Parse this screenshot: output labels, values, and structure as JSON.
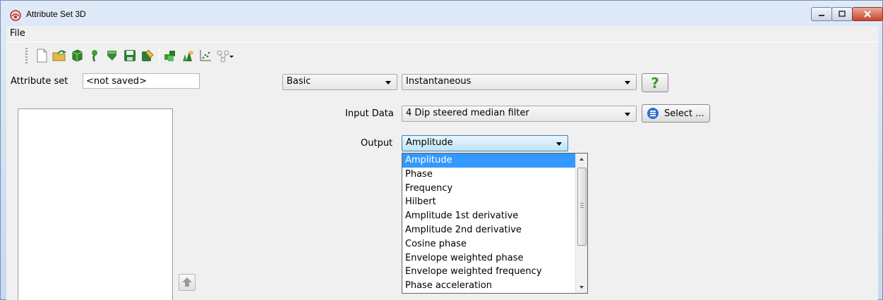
{
  "window": {
    "title": "Attribute Set 3D"
  },
  "menu": {
    "file": "File"
  },
  "toolbar": {
    "icons": [
      "new-file-icon",
      "open-folder-icon",
      "green-cube-icon",
      "tree-icon",
      "arrow-down-icon",
      "save-icon",
      "save-as-icon",
      "stacked-cubes-icon",
      "plants-icon",
      "crossplot-icon",
      "network-icon"
    ]
  },
  "attribute_set": {
    "label": "Attribute set",
    "value": "<not saved>"
  },
  "category_combo": {
    "value": "Basic"
  },
  "attribute_combo": {
    "value": "Instantaneous"
  },
  "help": {
    "symbol": "?"
  },
  "input_data": {
    "label": "Input Data",
    "value": "4 Dip steered median filter",
    "select_label": "Select ..."
  },
  "output": {
    "label": "Output",
    "value": "Amplitude",
    "options": [
      "Amplitude",
      "Phase",
      "Frequency",
      "Hilbert",
      "Amplitude 1st derivative",
      "Amplitude 2nd derivative",
      "Cosine phase",
      "Envelope weighted phase",
      "Envelope weighted frequency",
      "Phase acceleration"
    ],
    "selected_index": 0
  },
  "colors": {
    "selection": "#3399ff",
    "help_green": "#3a9a2a"
  }
}
